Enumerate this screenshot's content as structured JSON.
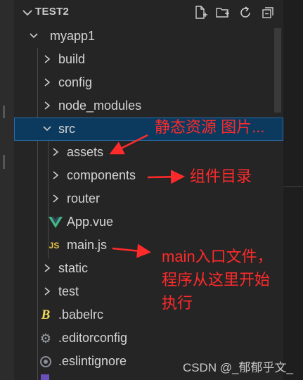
{
  "explorer": {
    "workspace_title": "TEST2",
    "toolbar": {
      "new_file_icon": "new-file-icon",
      "new_folder_icon": "new-folder-icon",
      "refresh_icon": "refresh-icon",
      "collapse_icon": "collapse-all-icon"
    },
    "tree": {
      "root": "myapp1",
      "build": "build",
      "config": "config",
      "node_modules": "node_modules",
      "src": "src",
      "assets": "assets",
      "components": "components",
      "router": "router",
      "app_vue": "App.vue",
      "main_js": "main.js",
      "main_js_badge": "JS",
      "static": "static",
      "test": "test",
      "babelrc": ".babelrc",
      "editorconfig": ".editorconfig",
      "eslintignore": ".eslintignore"
    }
  },
  "annotations": {
    "src_note": "静态资源 图片...",
    "components_note": "组件目录",
    "main_note_line1": "main入口文件，",
    "main_note_line2": "程序从这里开始",
    "main_note_line3": "执行"
  },
  "watermark": "CSDN @_郁郁乎文_",
  "colors": {
    "sidebar_bg": "#252526",
    "selected_bg": "#0b3a5e",
    "selected_border": "#2a6ea8",
    "annotation": "#ff2a2a",
    "vue_green": "#42b883",
    "js_yellow": "#e8c547"
  }
}
